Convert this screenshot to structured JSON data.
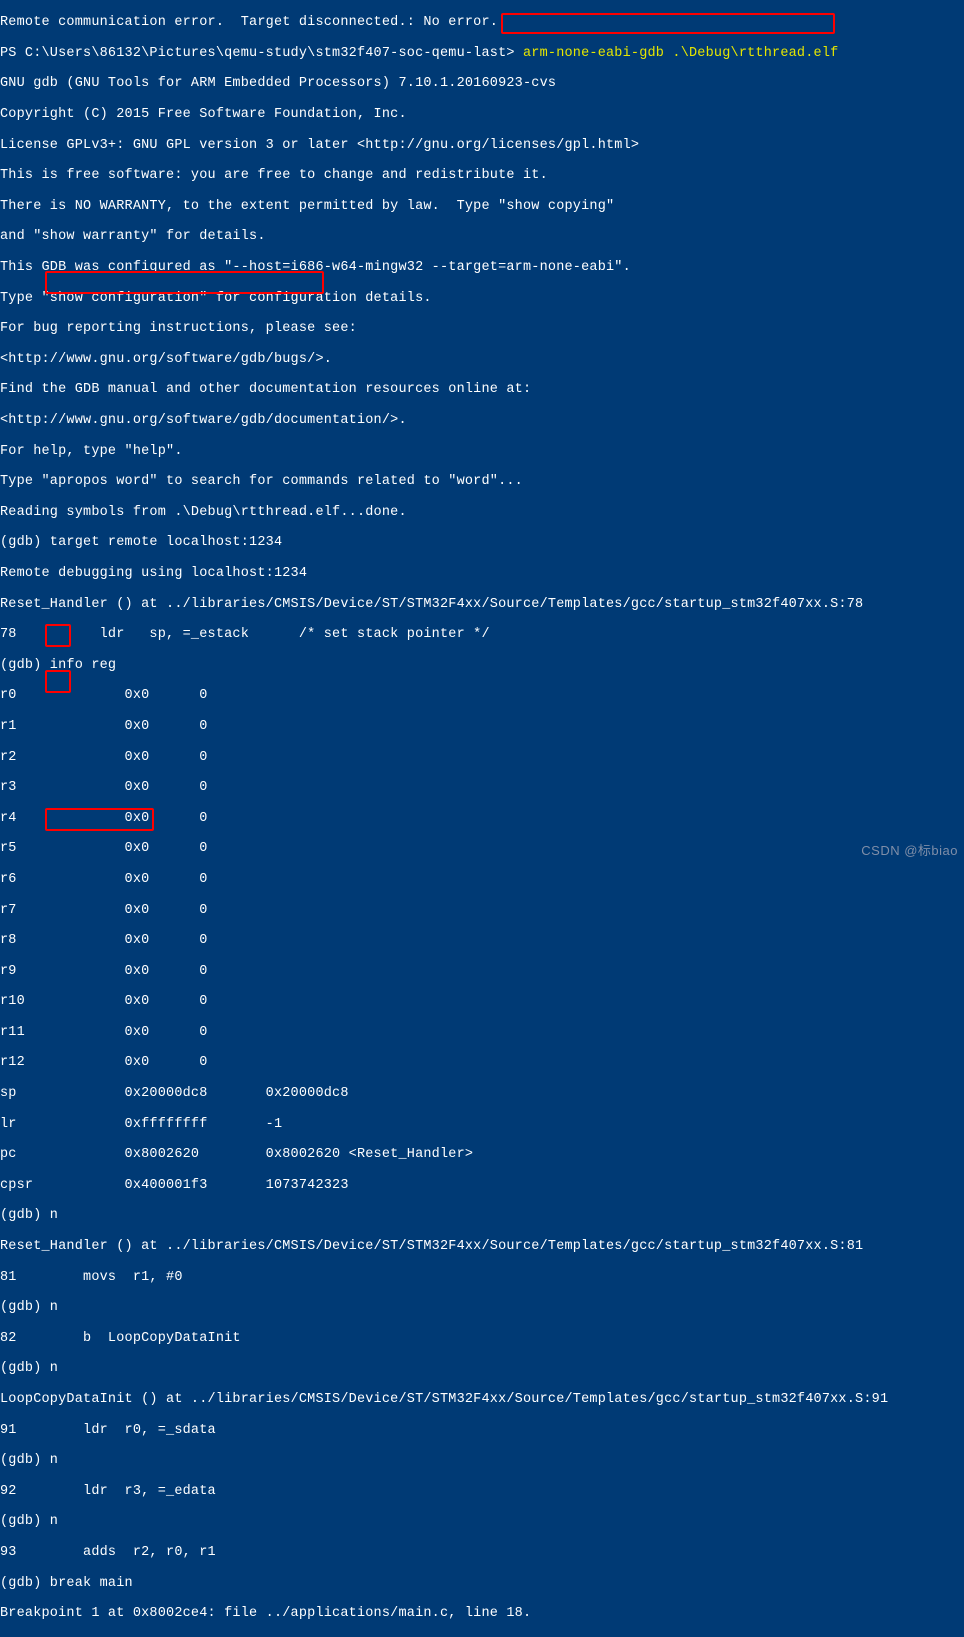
{
  "lines": {
    "l00": "Remote communication error.  Target disconnected.: No error.",
    "l01a": "PS C:\\Users\\86132\\Pictures\\qemu-study\\stm32f407-soc-qemu-last> ",
    "l01b": "arm-none-eabi-gdb .\\Debug\\rtthread.elf",
    "l02": "GNU gdb (GNU Tools for ARM Embedded Processors) 7.10.1.20160923-cvs",
    "l03": "Copyright (C) 2015 Free Software Foundation, Inc.",
    "l04": "License GPLv3+: GNU GPL version 3 or later <http://gnu.org/licenses/gpl.html>",
    "l05": "This is free software: you are free to change and redistribute it.",
    "l06": "There is NO WARRANTY, to the extent permitted by law.  Type \"show copying\"",
    "l07": "and \"show warranty\" for details.",
    "l08": "This GDB was configured as \"--host=i686-w64-mingw32 --target=arm-none-eabi\".",
    "l09": "Type \"show configuration\" for configuration details.",
    "l10": "For bug reporting instructions, please see:",
    "l11": "<http://www.gnu.org/software/gdb/bugs/>.",
    "l12": "Find the GDB manual and other documentation resources online at:",
    "l13": "<http://www.gnu.org/software/gdb/documentation/>.",
    "l14": "For help, type \"help\".",
    "l15": "Type \"apropos word\" to search for commands related to \"word\"...",
    "l16": "Reading symbols from .\\Debug\\rtthread.elf...done.",
    "l17": "(gdb) target remote localhost:1234",
    "l18": "Remote debugging using localhost:1234",
    "l19": "Reset_Handler () at ../libraries/CMSIS/Device/ST/STM32F4xx/Source/Templates/gcc/startup_stm32f407xx.S:78",
    "l20": "78          ldr   sp, =_estack      /* set stack pointer */",
    "l21": "(gdb) info reg",
    "l22": "r0             0x0      0",
    "l23": "r1             0x0      0",
    "l24": "r2             0x0      0",
    "l25": "r3             0x0      0",
    "l26": "r4             0x0      0",
    "l27": "r5             0x0      0",
    "l28": "r6             0x0      0",
    "l29": "r7             0x0      0",
    "l30": "r8             0x0      0",
    "l31": "r9             0x0      0",
    "l32": "r10            0x0      0",
    "l33": "r11            0x0      0",
    "l34": "r12            0x0      0",
    "l35": "sp             0x20000dc8       0x20000dc8",
    "l36": "lr             0xffffffff       -1",
    "l37": "pc             0x8002620        0x8002620 <Reset_Handler>",
    "l38": "cpsr           0x400001f3       1073742323",
    "l39": "(gdb) n",
    "l40": "Reset_Handler () at ../libraries/CMSIS/Device/ST/STM32F4xx/Source/Templates/gcc/startup_stm32f407xx.S:81",
    "l41": "81        movs  r1, #0",
    "l42": "(gdb) n",
    "l43": "82        b  LoopCopyDataInit",
    "l44": "(gdb) n",
    "l45": "LoopCopyDataInit () at ../libraries/CMSIS/Device/ST/STM32F4xx/Source/Templates/gcc/startup_stm32f407xx.S:91",
    "l46": "91        ldr  r0, =_sdata",
    "l47": "(gdb) n",
    "l48": "92        ldr  r3, =_edata",
    "l49": "(gdb) n",
    "l50": "93        adds  r2, r0, r1",
    "l51": "(gdb) break main",
    "l52": "Breakpoint 1 at 0x8002ce4: file ../applications/main.c, line 18."
  },
  "watermark": "CSDN @标biao",
  "highlights": {
    "box1": "arm-none-eabi-gdb .\\Debug\\rtthread.elf",
    "box2": "target remote localhost:1234",
    "box3": "n",
    "box4": "n",
    "box5": "break main"
  }
}
